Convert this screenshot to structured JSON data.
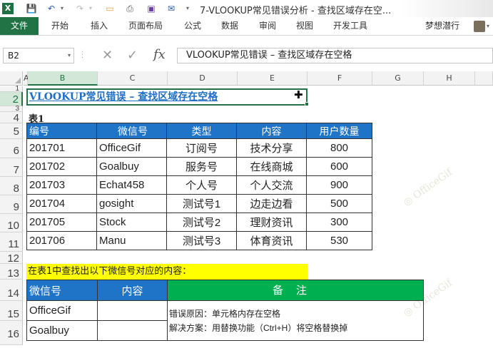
{
  "window": {
    "title": "7-VLOOKUP常见错误分析 - 查找区域存在空..."
  },
  "quick_access": {
    "app_icon": "X"
  },
  "ribbon": {
    "file_tab": "文件",
    "tabs": [
      "开始",
      "插入",
      "页面布局",
      "公式",
      "数据",
      "审阅",
      "视图",
      "开发工具"
    ],
    "user": "梦想潜行"
  },
  "formula_bar": {
    "name_box": "B2",
    "fx_label": "fx",
    "formula": "VLOOKUP常见错误 – 查找区域存在空格"
  },
  "grid": {
    "columns": [
      "A",
      "B",
      "C",
      "D",
      "E",
      "F",
      "G",
      "H"
    ],
    "selected_column": "B",
    "rows": [
      "1",
      "2",
      "3",
      "4",
      "5",
      "6",
      "7",
      "8",
      "9",
      "10",
      "11",
      "12",
      "13",
      "14",
      "15",
      "16"
    ],
    "selected_row": "2"
  },
  "sheet": {
    "title": "VLOOKUP常见错误 – 查找区域存在空格",
    "table1_label": "表1",
    "table1": {
      "headers": [
        "编号",
        "微信号",
        "类型",
        "内容",
        "用户数量"
      ],
      "rows": [
        [
          "201701",
          "OfficeGif",
          "订阅号",
          "技术分享",
          "800"
        ],
        [
          "201702",
          "Goalbuy",
          "服务号",
          "在线商城",
          "600"
        ],
        [
          "201703",
          "Echat458",
          "个人号",
          "个人交流",
          "900"
        ],
        [
          "201704",
          "gosight",
          "测试号1",
          "边走边看",
          "500"
        ],
        [
          "201705",
          "Stock",
          "测试号2",
          "理财资讯",
          "300"
        ],
        [
          "201706",
          "Manu",
          "测试号3",
          "体育资讯",
          "530"
        ]
      ]
    },
    "instruction": "在表1中查找出以下微信号对应的内容：",
    "table2": {
      "headers": [
        "微信号",
        "内容",
        "备注"
      ],
      "rows": [
        [
          "OfficeGif",
          ""
        ],
        [
          "Goalbuy",
          ""
        ]
      ],
      "note_line1": "错误原因：单元格内存在空格",
      "note_line2": "解决方案：用替换功能（Ctrl+H）将空格替换掉"
    }
  }
}
